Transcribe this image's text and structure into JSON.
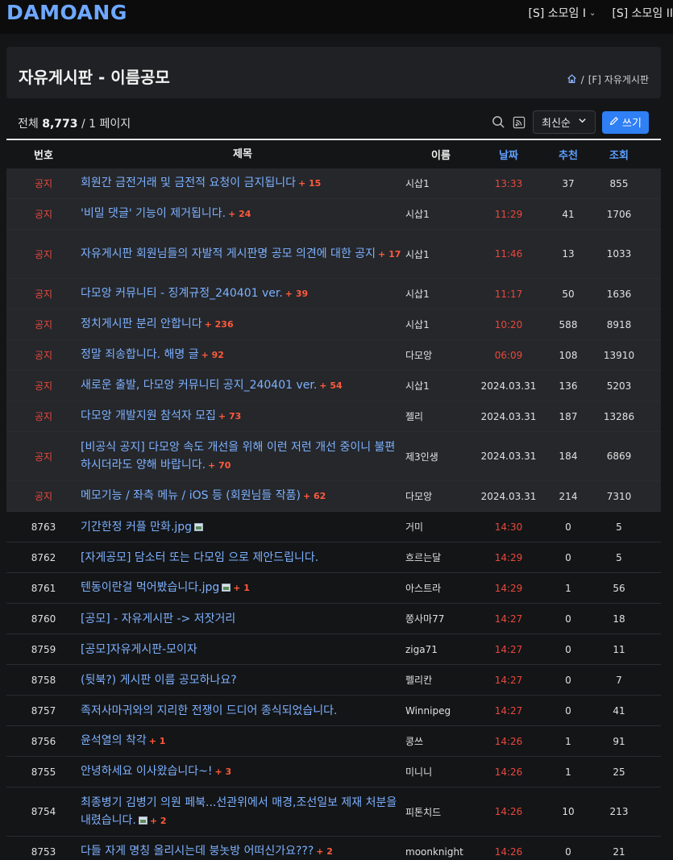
{
  "site": {
    "logo": "DAMOANG"
  },
  "nav": {
    "items": [
      {
        "label": "[S] 소모임 I"
      },
      {
        "label": "[S] 소모임 II"
      }
    ]
  },
  "header": {
    "title": "자유게시판 - 이름공모",
    "breadcrumb_sep": "/",
    "breadcrumb": "[F] 자유게시판"
  },
  "toolbar": {
    "total_label": "전체",
    "total_count": "8,773",
    "page_info": "/ 1 페이지",
    "sort_label": "최신순",
    "write_label": "쓰기"
  },
  "table": {
    "columns": {
      "num": "번호",
      "title": "제목",
      "name": "이름",
      "date": "날짜",
      "rec": "추천",
      "view": "조회"
    },
    "rows": [
      {
        "num": "공지",
        "notice": true,
        "title": "회원간 금전거래 및 금전적 요청이 금지됩니다",
        "comments": "+ 15",
        "img": false,
        "name": "시삽1",
        "date": "13:33",
        "date_red": true,
        "rec": "37",
        "view": "855",
        "h": 38
      },
      {
        "num": "공지",
        "notice": true,
        "title": "'비밀 댓글' 기능이 제거됩니다.",
        "comments": "+ 24",
        "img": false,
        "name": "시삽1",
        "date": "11:29",
        "date_red": true,
        "rec": "41",
        "view": "1706",
        "h": 38
      },
      {
        "num": "공지",
        "notice": true,
        "title": "자유게시판 회원님들의 자발적 게시판명 공모 의견에 대한 공지",
        "comments": "+ 17",
        "img": false,
        "name": "시삽1",
        "date": "11:46",
        "date_red": true,
        "rec": "13",
        "view": "1033",
        "h": 61
      },
      {
        "num": "공지",
        "notice": true,
        "title": "다모앙 커뮤니티 - 징계규정_240401 ver.",
        "comments": "+ 39",
        "img": false,
        "name": "시삽1",
        "date": "11:17",
        "date_red": true,
        "rec": "50",
        "view": "1636",
        "h": 38
      },
      {
        "num": "공지",
        "notice": true,
        "title": "정치게시판 분리 안합니다",
        "comments": "+ 236",
        "img": false,
        "name": "시삽1",
        "date": "10:20",
        "date_red": true,
        "rec": "588",
        "view": "8918",
        "h": 38
      },
      {
        "num": "공지",
        "notice": true,
        "title": "정말 죄송합니다. 해명 글",
        "comments": "+ 92",
        "img": false,
        "name": "다모앙",
        "date": "06:09",
        "date_red": true,
        "rec": "108",
        "view": "13910",
        "h": 38
      },
      {
        "num": "공지",
        "notice": true,
        "title": "새로운 출발, 다모앙 커뮤니티 공지_240401 ver.",
        "comments": "+ 54",
        "img": false,
        "name": "시삽1",
        "date": "2024.03.31",
        "date_red": false,
        "rec": "136",
        "view": "5203",
        "h": 38
      },
      {
        "num": "공지",
        "notice": true,
        "title": "다모앙 개발지원 참석자 모집",
        "comments": "+ 73",
        "img": false,
        "name": "젤리",
        "date": "2024.03.31",
        "date_red": false,
        "rec": "187",
        "view": "13286",
        "h": 38
      },
      {
        "num": "공지",
        "notice": true,
        "title": "[비공식 공지] 다모앙 속도 개선을 위해 이런 저런 개선 중이니 불편하시더라도 양해 바랍니다.",
        "comments": "+ 70",
        "img": false,
        "name": "제3인생",
        "date": "2024.03.31",
        "date_red": false,
        "rec": "184",
        "view": "6869",
        "h": 61
      },
      {
        "num": "공지",
        "notice": true,
        "title": "메모기능 / 좌측 메뉴 / iOS 등 (회원님들 작품)",
        "comments": "+ 62",
        "img": false,
        "name": "다모앙",
        "date": "2024.03.31",
        "date_red": false,
        "rec": "214",
        "view": "7310",
        "h": 38
      },
      {
        "num": "8763",
        "notice": false,
        "title": "기간한정 커플 만화.jpg",
        "comments": "",
        "img": true,
        "name": "거미",
        "date": "14:30",
        "date_red": true,
        "rec": "0",
        "view": "5",
        "h": 38
      },
      {
        "num": "8762",
        "notice": false,
        "title": "[자게공모] 담소터 또는 다모임 으로 제안드립니다.",
        "comments": "",
        "img": false,
        "name": "흐르는달",
        "date": "14:29",
        "date_red": true,
        "rec": "0",
        "view": "5",
        "h": 38
      },
      {
        "num": "8761",
        "notice": false,
        "title": "텐동이란걸 먹어봤습니다.jpg",
        "comments": "+ 1",
        "img": true,
        "name": "아스트라",
        "date": "14:29",
        "date_red": true,
        "rec": "1",
        "view": "56",
        "h": 38
      },
      {
        "num": "8760",
        "notice": false,
        "title": "[공모] - 자유게시판 -> 저잣거리",
        "comments": "",
        "img": false,
        "name": "쫑사마77",
        "date": "14:27",
        "date_red": true,
        "rec": "0",
        "view": "18",
        "h": 38
      },
      {
        "num": "8759",
        "notice": false,
        "title": "[공모]자유게시판-모이자",
        "comments": "",
        "img": false,
        "name": "ziga71",
        "date": "14:27",
        "date_red": true,
        "rec": "0",
        "view": "11",
        "h": 38
      },
      {
        "num": "8758",
        "notice": false,
        "title": "(뒷북?) 게시판 이름 공모하나요?",
        "comments": "",
        "img": false,
        "name": "펠리칸",
        "date": "14:27",
        "date_red": true,
        "rec": "0",
        "view": "7",
        "h": 38
      },
      {
        "num": "8757",
        "notice": false,
        "title": "족저사마귀와의 지리한 전쟁이 드디어 종식되었습니다.",
        "comments": "",
        "img": false,
        "name": "Winnipeg",
        "date": "14:27",
        "date_red": true,
        "rec": "0",
        "view": "41",
        "h": 38
      },
      {
        "num": "8756",
        "notice": false,
        "title": "윤석열의 착각",
        "comments": "+ 1",
        "img": false,
        "name": "콩쓰",
        "date": "14:26",
        "date_red": true,
        "rec": "1",
        "view": "91",
        "h": 38
      },
      {
        "num": "8755",
        "notice": false,
        "title": "안녕하세요 이사왔습니다~!",
        "comments": "+ 3",
        "img": false,
        "name": "미니니",
        "date": "14:26",
        "date_red": true,
        "rec": "1",
        "view": "25",
        "h": 38
      },
      {
        "num": "8754",
        "notice": false,
        "title": "최종병기 김병기 의원 페북...선관위에서 매경,조선일보 제재 처분을 내렸습니다.",
        "comments": "+ 2",
        "img": true,
        "name": "피톤치드",
        "date": "14:26",
        "date_red": true,
        "rec": "10",
        "view": "213",
        "h": 61
      },
      {
        "num": "8753",
        "notice": false,
        "title": "다들 자게 명칭 올리시는데 붕놋방 어떠신가요???",
        "comments": "+ 2",
        "img": false,
        "name": "moonknight",
        "date": "14:26",
        "date_red": true,
        "rec": "0",
        "view": "21",
        "h": 38
      }
    ]
  },
  "colors": {
    "accent": "#2f7ff5",
    "link": "#7db1ff",
    "notice_red": "#e9483c",
    "comment_red": "#ff5a3c",
    "logo": "#6ea8ff"
  },
  "icons": {
    "home": "home-icon",
    "search": "search-icon",
    "rss": "rss-icon",
    "write": "pencil-icon",
    "sort": "chevron-down-icon"
  }
}
